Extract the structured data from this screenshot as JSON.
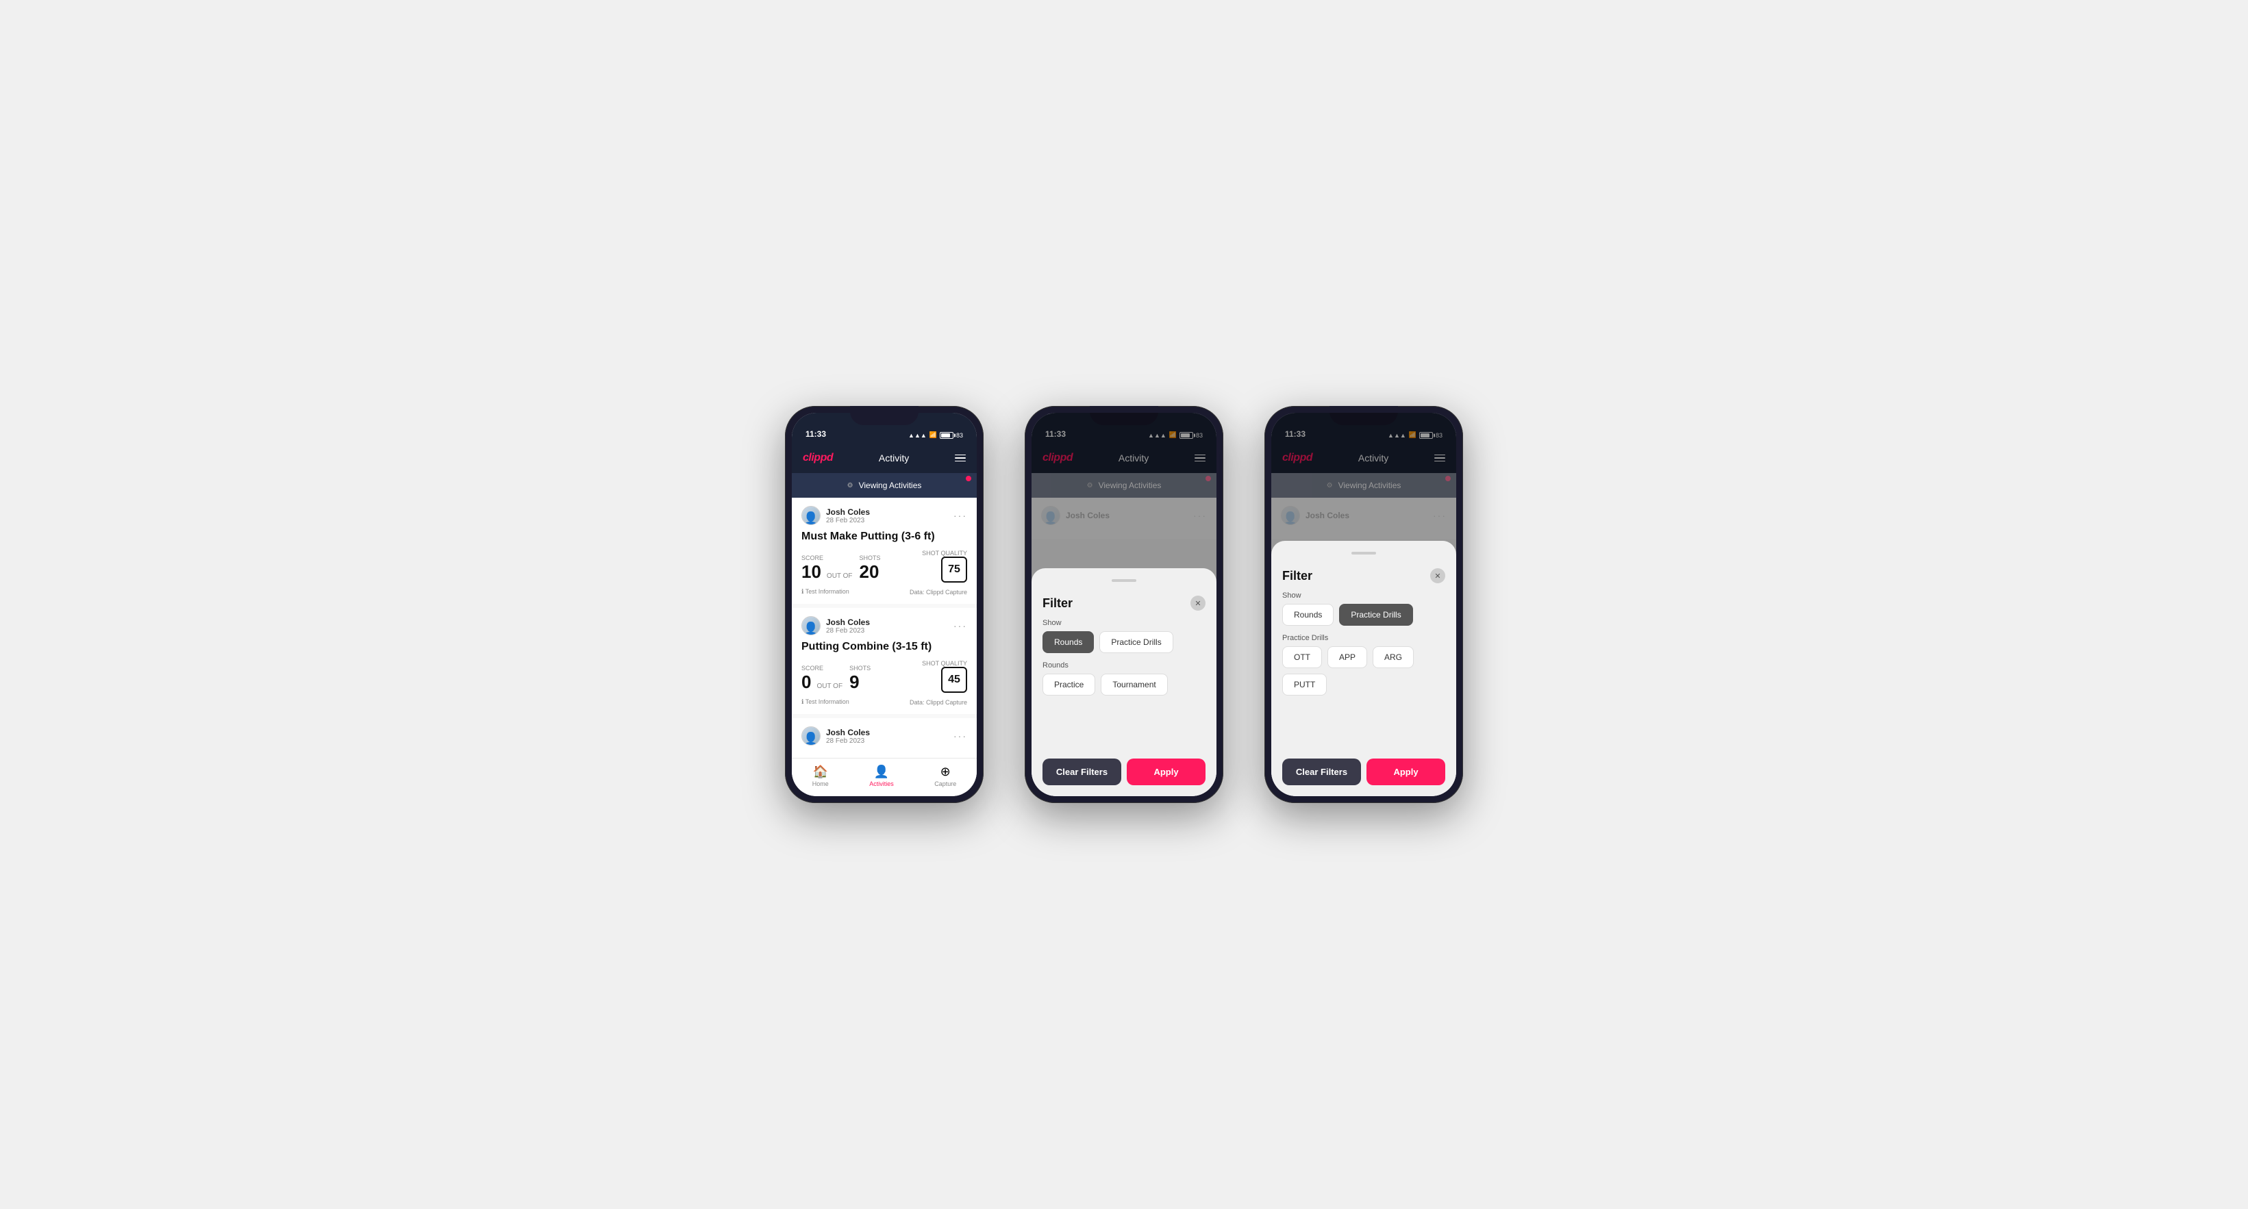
{
  "app": {
    "logo": "clippd",
    "title": "Activity",
    "status_time": "11:33",
    "battery": "83"
  },
  "viewing_banner": {
    "text": "Viewing Activities",
    "icon": "⚙"
  },
  "phones": [
    {
      "id": "phone1",
      "type": "activity_list",
      "cards": [
        {
          "user_name": "Josh Coles",
          "user_date": "28 Feb 2023",
          "title": "Must Make Putting (3-6 ft)",
          "score_label": "Score",
          "score": "10",
          "out_of": "OUT OF",
          "shots_label": "Shots",
          "shots": "20",
          "shot_quality_label": "Shot Quality",
          "shot_quality": "75",
          "test_info": "Test Information",
          "data_source": "Data: Clippd Capture"
        },
        {
          "user_name": "Josh Coles",
          "user_date": "28 Feb 2023",
          "title": "Putting Combine (3-15 ft)",
          "score_label": "Score",
          "score": "0",
          "out_of": "OUT OF",
          "shots_label": "Shots",
          "shots": "9",
          "shot_quality_label": "Shot Quality",
          "shot_quality": "45",
          "test_info": "Test Information",
          "data_source": "Data: Clippd Capture"
        },
        {
          "user_name": "Josh Coles",
          "user_date": "28 Feb 2023",
          "title": "",
          "score_label": "",
          "score": "",
          "out_of": "",
          "shots_label": "",
          "shots": "",
          "shot_quality_label": "",
          "shot_quality": "",
          "test_info": "",
          "data_source": ""
        }
      ],
      "nav": {
        "home_label": "Home",
        "activities_label": "Activities",
        "capture_label": "Capture"
      }
    },
    {
      "id": "phone2",
      "type": "filter_rounds",
      "filter": {
        "title": "Filter",
        "show_label": "Show",
        "show_buttons": [
          {
            "label": "Rounds",
            "active": true
          },
          {
            "label": "Practice Drills",
            "active": false
          }
        ],
        "rounds_label": "Rounds",
        "rounds_buttons": [
          {
            "label": "Practice",
            "active": false
          },
          {
            "label": "Tournament",
            "active": false
          }
        ],
        "clear_label": "Clear Filters",
        "apply_label": "Apply"
      }
    },
    {
      "id": "phone3",
      "type": "filter_practice",
      "filter": {
        "title": "Filter",
        "show_label": "Show",
        "show_buttons": [
          {
            "label": "Rounds",
            "active": false
          },
          {
            "label": "Practice Drills",
            "active": true
          }
        ],
        "practice_drills_label": "Practice Drills",
        "practice_buttons": [
          {
            "label": "OTT",
            "active": false
          },
          {
            "label": "APP",
            "active": false
          },
          {
            "label": "ARG",
            "active": false
          },
          {
            "label": "PUTT",
            "active": false
          }
        ],
        "clear_label": "Clear Filters",
        "apply_label": "Apply"
      }
    }
  ]
}
